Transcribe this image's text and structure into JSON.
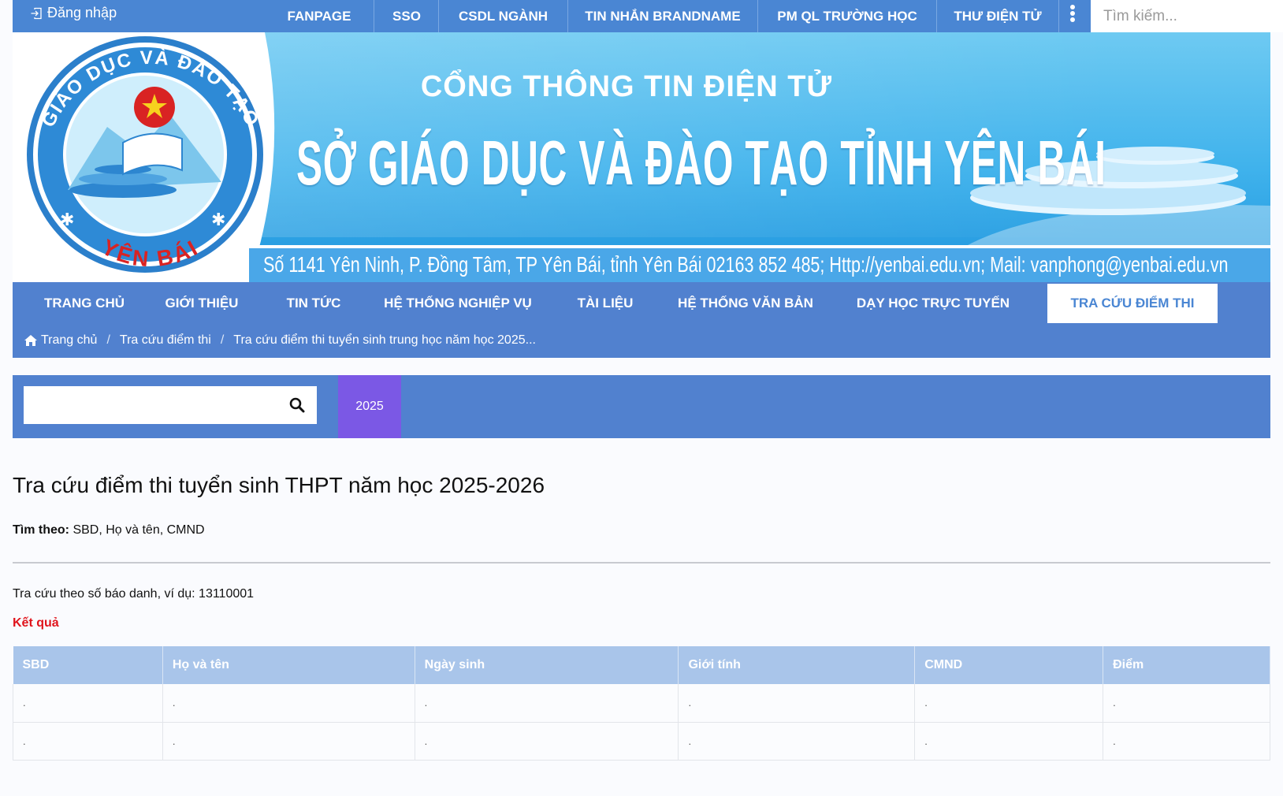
{
  "topbar": {
    "login_label": "Đăng nhập",
    "nav": [
      "FANPAGE",
      "SSO",
      "CSDL NGÀNH",
      "TIN NHẮN BRANDNAME",
      "PM QL TRƯỜNG HỌC",
      "THƯ ĐIỆN TỬ"
    ],
    "more_icon": "kebab-menu-icon",
    "search": {
      "placeholder": "Tìm kiếm...",
      "value": "",
      "mic_icon": "microphone-icon"
    }
  },
  "banner": {
    "subtitle": "CỔNG THÔNG TIN ĐIỆN TỬ",
    "title": "SỞ GIÁO DỤC VÀ ĐÀO TẠO TỈNH YÊN BÁI",
    "address": "Số 1141 Yên Ninh, P. Đồng Tâm, TP Yên Bái, tỉnh Yên Bái  02163 852 485; Http://yenbai.edu.vn; Mail: vanphong@yenbai.edu.vn",
    "logo": {
      "ring_top": "GIÁO DỤC VÀ ĐÀO TẠO",
      "ring_bottom": "YÊN BÁI"
    }
  },
  "mainnav": {
    "items": [
      "TRANG CHỦ",
      "GIỚI THIỆU",
      "TIN TỨC",
      "HỆ THỐNG NGHIỆP VỤ",
      "TÀI LIỆU",
      "HỆ THỐNG VĂN BẢN",
      "DẠY HỌC TRỰC TUYẾN",
      "TRA CỨU ĐIỂM THI"
    ],
    "active": "TRA CỨU ĐIỂM THI"
  },
  "breadcrumb": {
    "home_icon": "home-icon",
    "items": [
      "Trang chủ",
      "Tra cứu điểm thi",
      "Tra cứu điểm thi tuyển sinh trung học năm học 2025..."
    ],
    "separator": "/"
  },
  "filter": {
    "input_value": "",
    "input_placeholder": "",
    "search_icon": "search-icon",
    "year_tab": "2025"
  },
  "content": {
    "title": "Tra cứu điểm thi tuyển sinh THPT năm học 2025-2026",
    "search_by_label": "Tìm theo:",
    "search_by_value": "SBD, Họ và tên, CMND",
    "hint": "Tra cứu theo số báo danh, ví dụ: 13110001",
    "result_label": "Kết quả"
  },
  "table": {
    "columns": [
      "SBD",
      "Họ và tên",
      "Ngày sinh",
      "Giới tính",
      "CMND",
      "Điểm"
    ],
    "rows": [
      [
        ".",
        ".",
        ".",
        ".",
        ".",
        "."
      ],
      [
        ".",
        ".",
        ".",
        ".",
        ".",
        "."
      ]
    ]
  },
  "colors": {
    "topbar": "#4a86d3",
    "nav": "#5181cf",
    "year_tab": "#7b58e5",
    "result_label": "#e0141c",
    "table_header": "#a9c5ea"
  }
}
